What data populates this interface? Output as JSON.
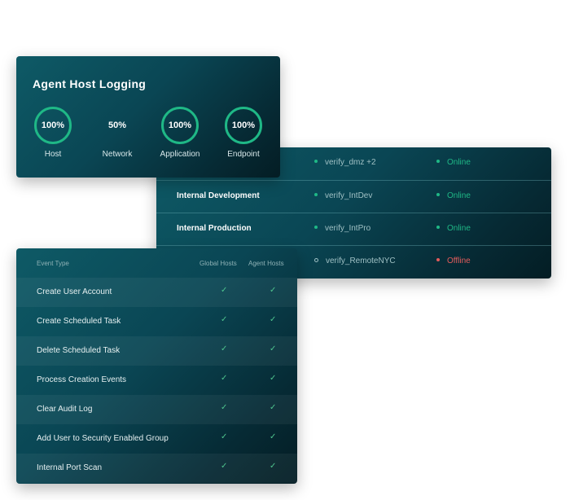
{
  "logging": {
    "title": "Agent Host Logging",
    "gauges": [
      {
        "value": "100%",
        "label": "Host",
        "fraction": 1.0
      },
      {
        "value": "50%",
        "label": "Network",
        "fraction": 0.5
      },
      {
        "value": "100%",
        "label": "Application",
        "fraction": 1.0
      },
      {
        "value": "100%",
        "label": "Endpoint",
        "fraction": 1.0
      }
    ],
    "ring_color": "#1fb886"
  },
  "environments": {
    "rows": [
      {
        "name": "",
        "host": "verify_dmz +2",
        "status": "Online"
      },
      {
        "name": "Internal Development",
        "host": "verify_IntDev",
        "status": "Online"
      },
      {
        "name": "Internal Production",
        "host": "verify_IntPro",
        "status": "Online"
      },
      {
        "name": "",
        "host": "verify_RemoteNYC",
        "status": "Offline"
      }
    ],
    "status_colors": {
      "Online": "#1fb886",
      "Offline": "#e25c5c"
    }
  },
  "events": {
    "headers": {
      "type": "Event Type",
      "global": "Global Hosts",
      "agent": "Agent Hosts"
    },
    "check_icon": "check-icon",
    "rows": [
      {
        "name": "Create User Account",
        "global": "✓",
        "agent": "✓"
      },
      {
        "name": "Create Scheduled Task",
        "global": "✓",
        "agent": "✓"
      },
      {
        "name": "Delete Scheduled Task",
        "global": "✓",
        "agent": "✓"
      },
      {
        "name": "Process Creation Events",
        "global": "✓",
        "agent": "✓"
      },
      {
        "name": "Clear Audit Log",
        "global": "✓",
        "agent": "✓"
      },
      {
        "name": "Add User to Security Enabled Group",
        "global": "✓",
        "agent": "✓"
      },
      {
        "name": "Internal Port Scan",
        "global": "✓",
        "agent": "✓"
      }
    ]
  }
}
